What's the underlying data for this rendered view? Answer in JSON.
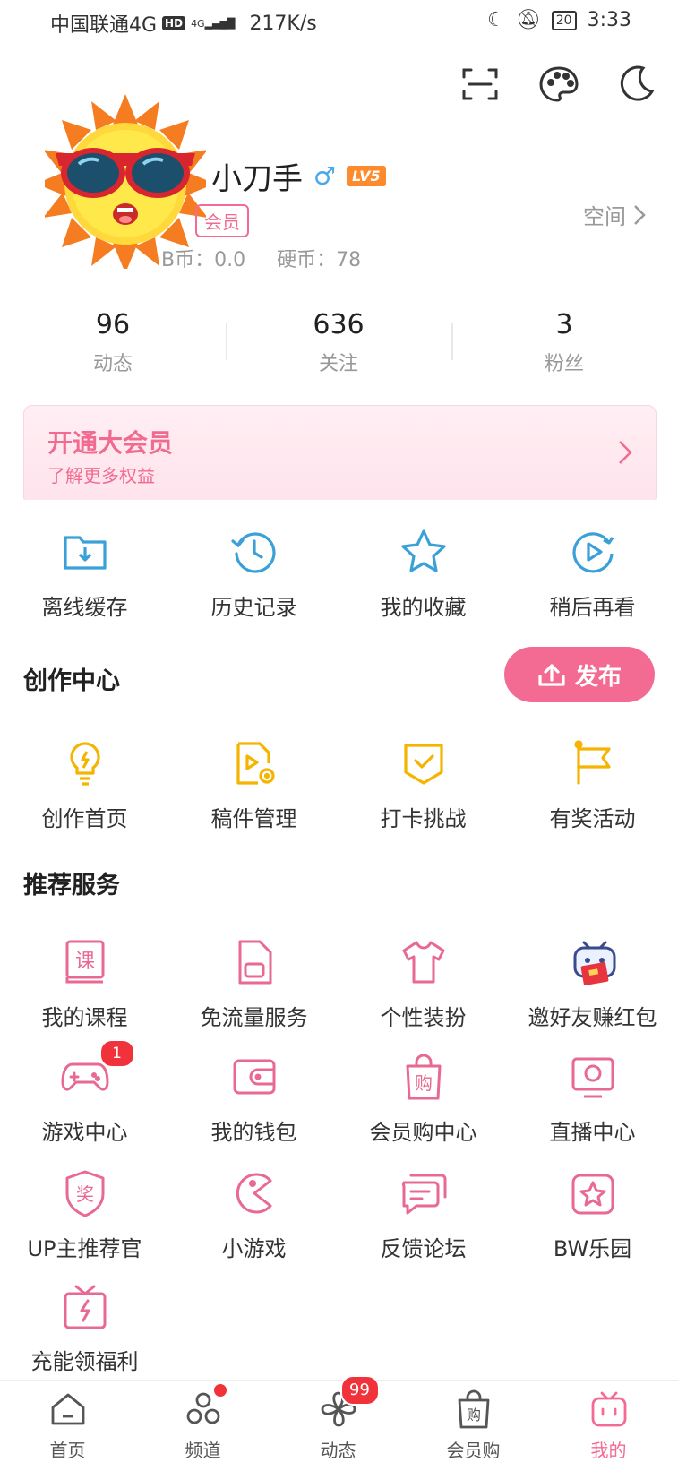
{
  "status_bar": {
    "carrier": "中国联通4G",
    "hd": "HD",
    "net_type": "4G",
    "speed": "217K/s",
    "battery": "20",
    "time": "3:33"
  },
  "profile": {
    "name_partial": "小刀手",
    "gender_symbol": "♂",
    "level": "LV5",
    "vip_badge": "会员",
    "b_coins": "B币：0.0",
    "coins": "硬币：78",
    "space_link": "空间"
  },
  "stats": [
    {
      "value": "96",
      "label": "动态"
    },
    {
      "value": "636",
      "label": "关注"
    },
    {
      "value": "3",
      "label": "粉丝"
    }
  ],
  "vip_banner": {
    "title": "开通大会员",
    "subtitle": "了解更多权益"
  },
  "quick_actions": [
    {
      "label": "离线缓存",
      "icon": "download-folder-icon"
    },
    {
      "label": "历史记录",
      "icon": "history-icon"
    },
    {
      "label": "我的收藏",
      "icon": "star-icon"
    },
    {
      "label": "稍后再看",
      "icon": "watch-later-icon"
    }
  ],
  "creation": {
    "title": "创作中心",
    "publish_label": "发布",
    "items": [
      {
        "label": "创作首页",
        "icon": "lightbulb-icon"
      },
      {
        "label": "稿件管理",
        "icon": "manuscript-icon"
      },
      {
        "label": "打卡挑战",
        "icon": "checkin-icon"
      },
      {
        "label": "有奖活动",
        "icon": "flag-icon"
      }
    ]
  },
  "services": {
    "title": "推荐服务",
    "items": [
      {
        "label": "我的课程",
        "icon": "course-icon",
        "glyph": "课"
      },
      {
        "label": "免流量服务",
        "icon": "sim-card-icon"
      },
      {
        "label": "个性装扮",
        "icon": "tshirt-icon"
      },
      {
        "label": "邀好友赚红包",
        "icon": "mascot-redpacket-icon"
      },
      {
        "label": "游戏中心",
        "icon": "gamepad-icon",
        "badge": "1"
      },
      {
        "label": "我的钱包",
        "icon": "wallet-icon"
      },
      {
        "label": "会员购中心",
        "icon": "shopping-bag-icon",
        "glyph": "购"
      },
      {
        "label": "直播中心",
        "icon": "live-tv-icon"
      },
      {
        "label": "UP主推荐官",
        "icon": "award-shield-icon",
        "glyph": "奖"
      },
      {
        "label": "小游戏",
        "icon": "pacman-icon"
      },
      {
        "label": "反馈论坛",
        "icon": "chat-bubbles-icon"
      },
      {
        "label": "BW乐园",
        "icon": "bw-park-icon"
      },
      {
        "label": "充能领福利",
        "icon": "gift-charge-icon"
      }
    ]
  },
  "bottom_nav": [
    {
      "label": "首页",
      "icon": "home-icon"
    },
    {
      "label": "频道",
      "icon": "channel-icon",
      "dot": true
    },
    {
      "label": "动态",
      "icon": "pinwheel-icon",
      "badge": "99"
    },
    {
      "label": "会员购",
      "icon": "shop-bag-icon",
      "glyph": "购"
    },
    {
      "label": "我的",
      "icon": "tv-mascot-icon",
      "active": true
    }
  ],
  "colors": {
    "accent": "#f36b92",
    "blue_icon": "#3aa0d8",
    "yellow_icon": "#f4b400"
  }
}
